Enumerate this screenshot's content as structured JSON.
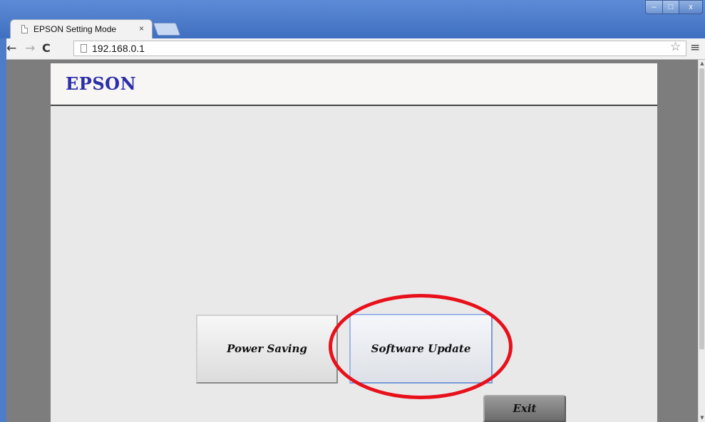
{
  "browser": {
    "tab": {
      "title": "EPSON Setting Mode",
      "close": "×"
    },
    "window_controls": {
      "minimize": "–",
      "maximize": "□",
      "close": "x"
    },
    "nav": {
      "back": "←",
      "forward": "→",
      "reload": "C"
    },
    "address_bar": {
      "url": "192.168.0.1"
    },
    "bookmark_star": "☆",
    "menu": "≡",
    "scrollbar": {
      "up": "▲",
      "down": "▼"
    }
  },
  "page": {
    "brand": "EPSON",
    "buttons": {
      "power_saving": "Power Saving",
      "software_update": "Software Update",
      "exit": "Exit"
    }
  },
  "colors": {
    "brand": "#2b2fa8",
    "annotation": "#e8101a"
  }
}
